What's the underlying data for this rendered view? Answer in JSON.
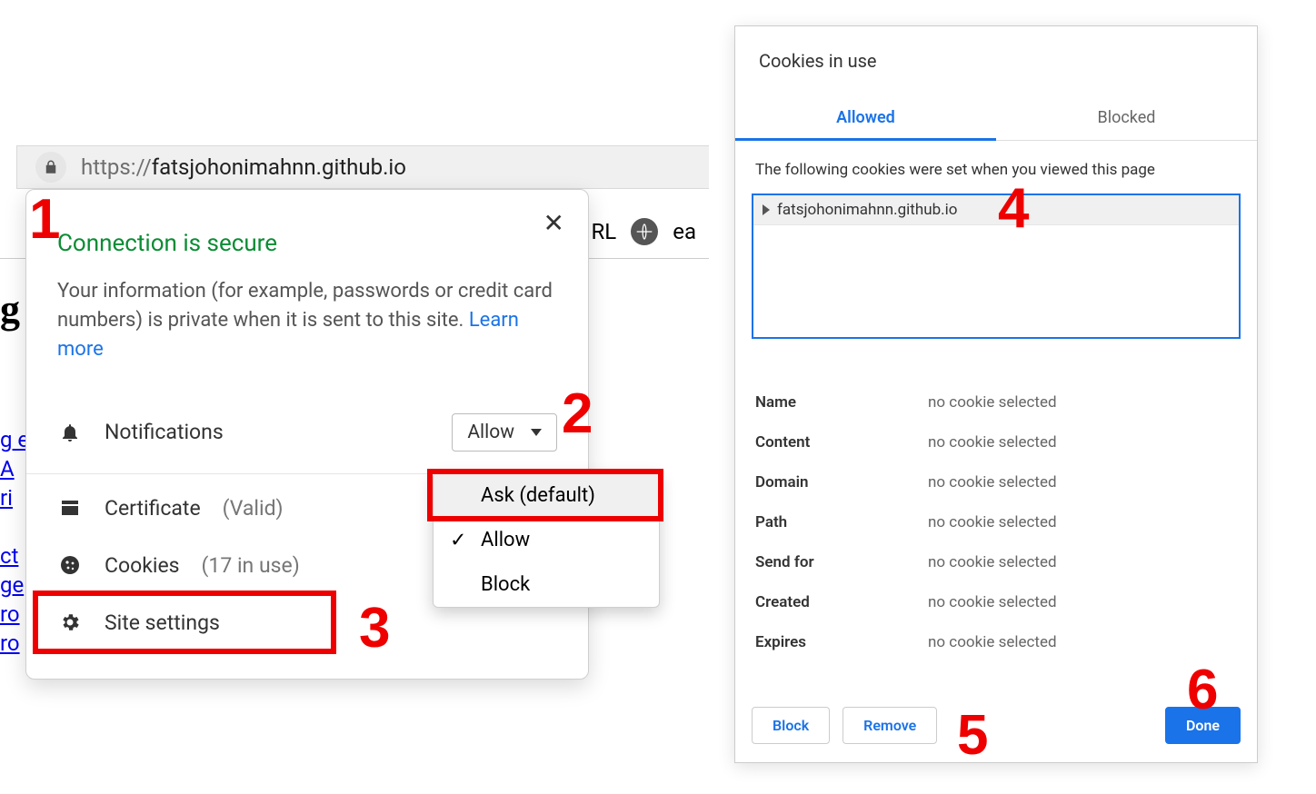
{
  "address_bar": {
    "url_prefix": "https://",
    "url_host": "fatsjohonimahnn.github.io"
  },
  "background": {
    "right_text_1": "RL",
    "right_text_2": "ea",
    "big_letter": "g",
    "frags": [
      "g e",
      "A",
      "ri",
      "",
      "ct",
      "ge",
      "ro",
      "ro"
    ]
  },
  "popover": {
    "close": "✕",
    "secure": "Connection is secure",
    "desc": "Your information (for example, passwords or credit card numbers) is private when it is sent to this site. ",
    "learn_more": "Learn more",
    "notifications_label": "Notifications",
    "allow_label": "Allow",
    "dropdown": {
      "ask": "Ask (default)",
      "allow": "Allow",
      "block": "Block"
    },
    "certificate_label": "Certificate",
    "certificate_status": "(Valid)",
    "cookies_label": "Cookies",
    "cookies_count": "(17 in use)",
    "site_settings_label": "Site settings"
  },
  "cookies_dialog": {
    "title": "Cookies in use",
    "tabs": {
      "allowed": "Allowed",
      "blocked": "Blocked"
    },
    "hint": "The following cookies were set when you viewed this page",
    "tree_item": "fatsjohonimahnn.github.io",
    "details": {
      "name_k": "Name",
      "name_v": "no cookie selected",
      "content_k": "Content",
      "content_v": "no cookie selected",
      "domain_k": "Domain",
      "domain_v": "no cookie selected",
      "path_k": "Path",
      "path_v": "no cookie selected",
      "sendfor_k": "Send for",
      "sendfor_v": "no cookie selected",
      "created_k": "Created",
      "created_v": "no cookie selected",
      "expires_k": "Expires",
      "expires_v": "no cookie selected"
    },
    "buttons": {
      "block": "Block",
      "remove": "Remove",
      "done": "Done"
    }
  },
  "annotations": {
    "n1": "1",
    "n2": "2",
    "n3": "3",
    "n4": "4",
    "n5": "5",
    "n6": "6"
  }
}
